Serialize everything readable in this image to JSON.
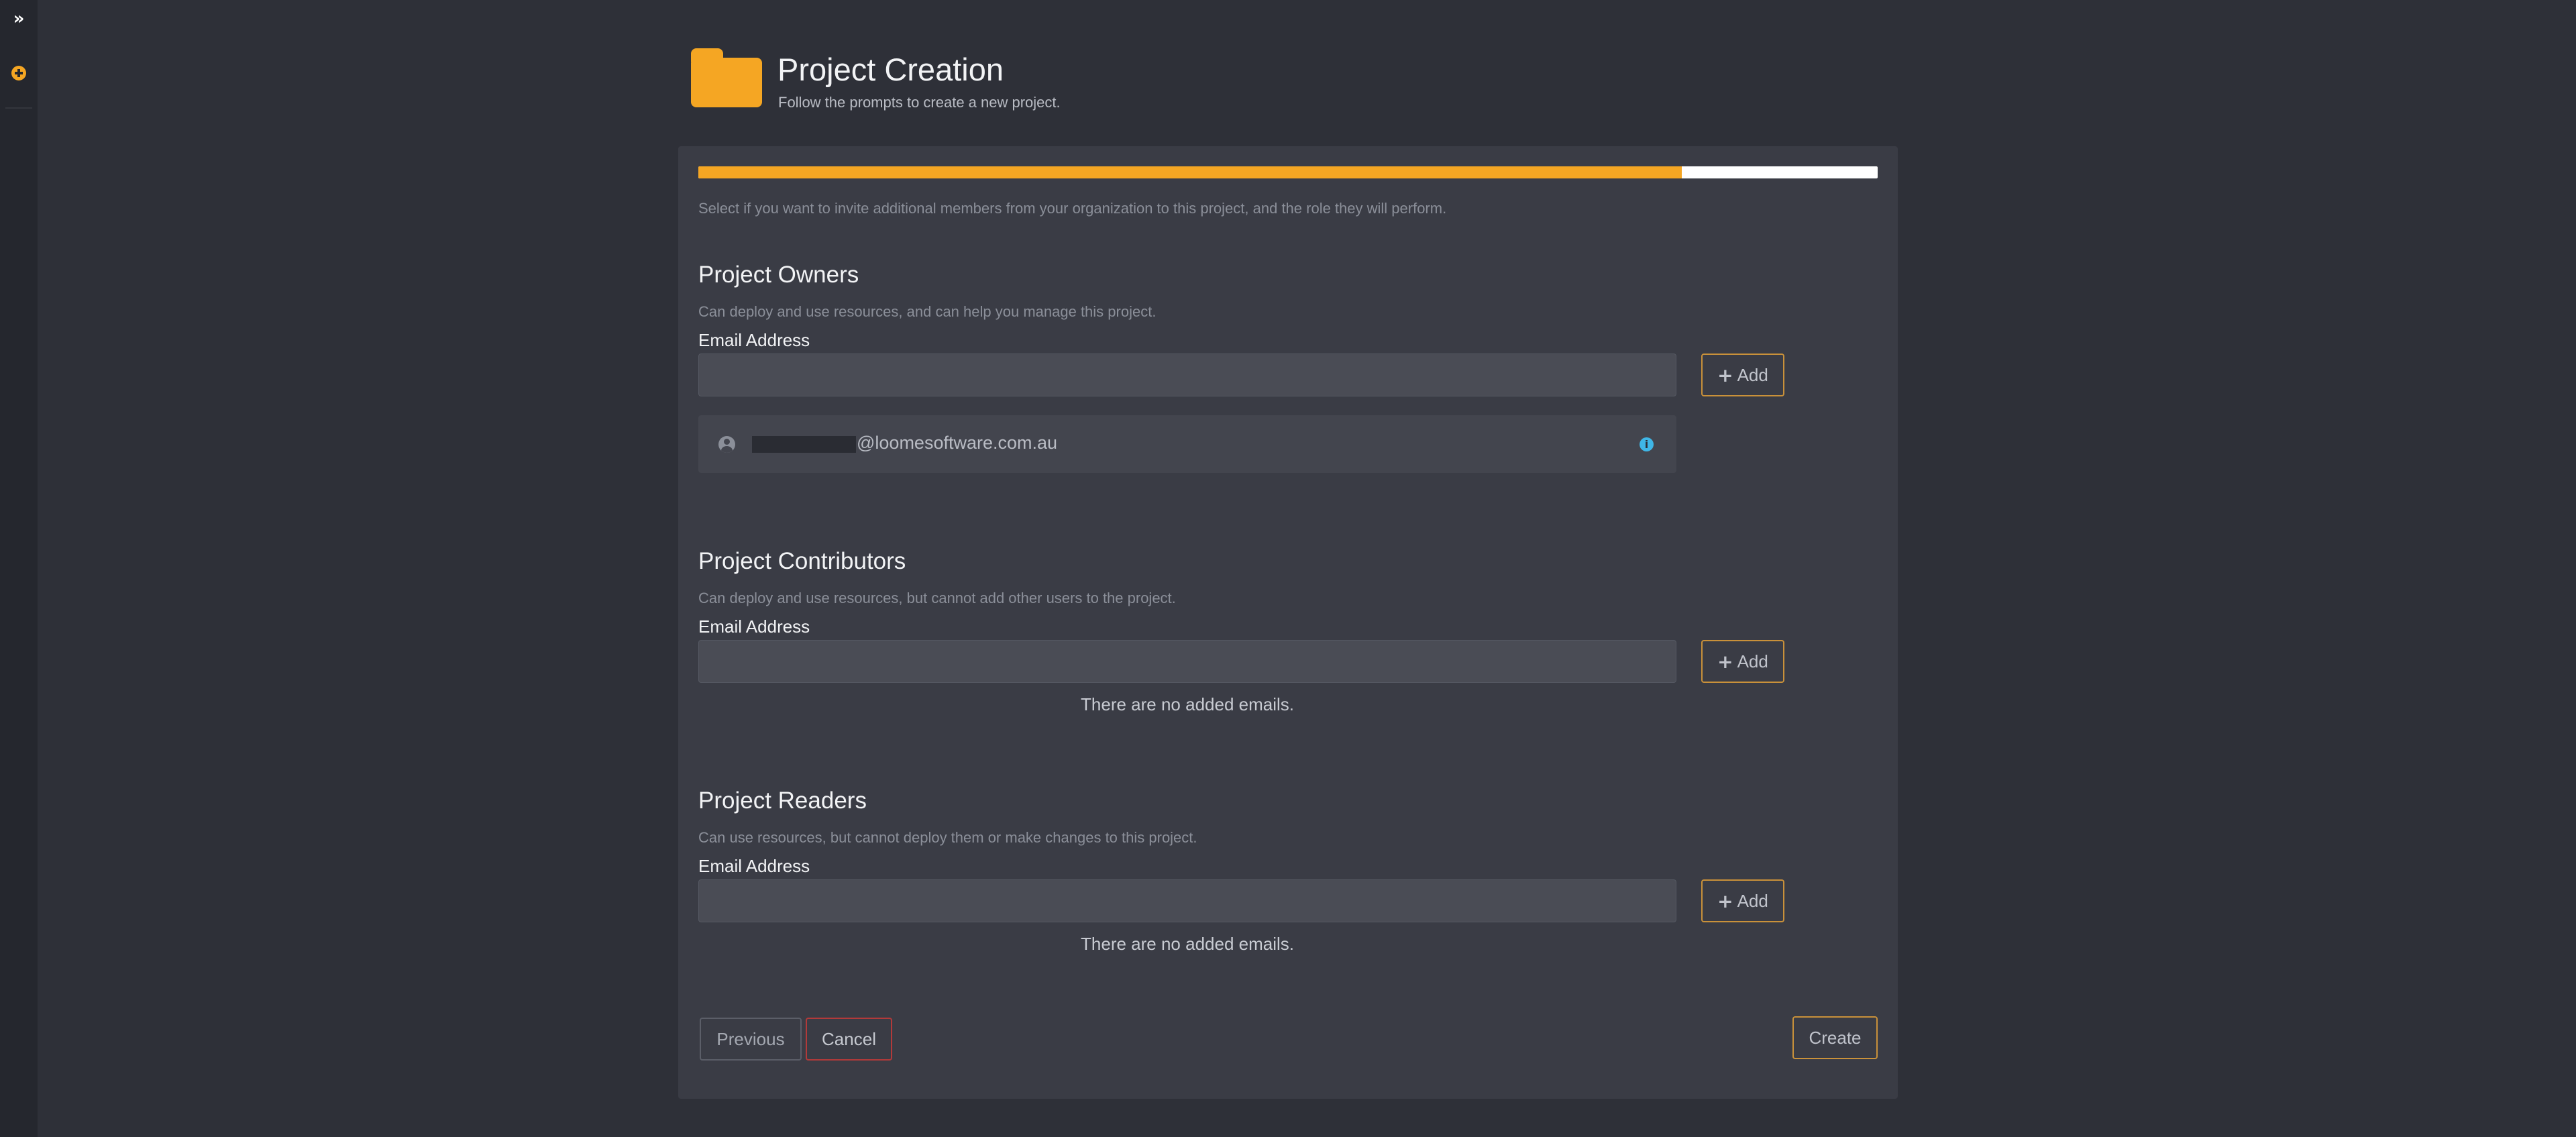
{
  "sidebar": {
    "expand_icon": "double-chevron-right-icon",
    "add_icon": "plus-circle-icon"
  },
  "header": {
    "icon": "folder-icon",
    "title": "Project Creation",
    "subtitle": "Follow the prompts to create a new project."
  },
  "progress": {
    "percent": 83.4
  },
  "intro": "Select if you want to invite additional members from your organization to this project, and the role they will perform.",
  "owners": {
    "title": "Project Owners",
    "description": "Can deploy and use resources, and can help you manage this project.",
    "field_label": "Email Address",
    "input_value": "",
    "add_label": "Add",
    "emails": [
      {
        "domain": "@loomesoftware.com.au"
      }
    ]
  },
  "contributors": {
    "title": "Project Contributors",
    "description": "Can deploy and use resources, but cannot add other users to the project.",
    "field_label": "Email Address",
    "input_value": "",
    "add_label": "Add",
    "empty_text": "There are no added emails."
  },
  "readers": {
    "title": "Project Readers",
    "description": "Can use resources, but cannot deploy them or make changes to this project.",
    "field_label": "Email Address",
    "input_value": "",
    "add_label": "Add",
    "empty_text": "There are no added emails."
  },
  "footer": {
    "previous_label": "Previous",
    "cancel_label": "Cancel",
    "create_label": "Create"
  },
  "colors": {
    "accent": "#f5a623",
    "danger": "#b23a3a",
    "info": "#3fb6e6"
  }
}
